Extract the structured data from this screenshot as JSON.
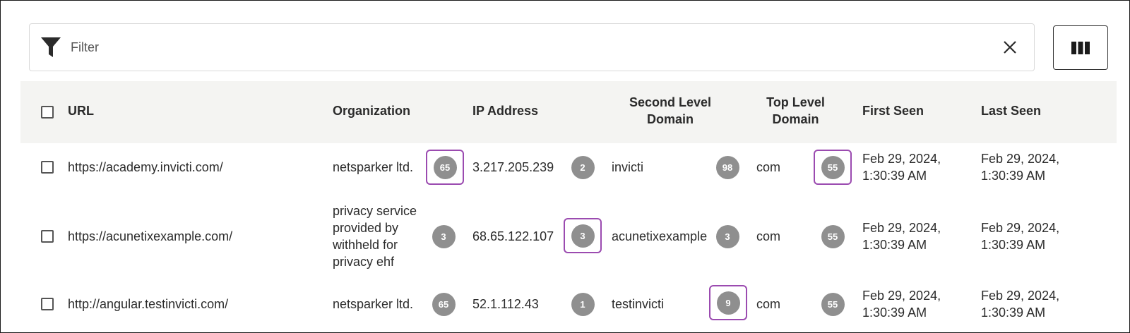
{
  "filter": {
    "placeholder": "Filter"
  },
  "icons": {
    "filter": "filter-funnel-icon",
    "clear": "close-x-icon",
    "columns": "columns-icon"
  },
  "colors": {
    "highlight": "#9b4bb0",
    "badge": "#8f8f8f",
    "header_bg": "#f4f4f2"
  },
  "table": {
    "headers": {
      "url": "URL",
      "organization": "Organization",
      "ip_address": "IP Address",
      "sld_line1": "Second Level",
      "sld_line2": "Domain",
      "tld_line1": "Top Level",
      "tld_line2": "Domain",
      "first_seen": "First Seen",
      "last_seen": "Last Seen"
    },
    "rows": [
      {
        "url": "https://academy.invicti.com/",
        "org_lines": [
          "netsparker ltd."
        ],
        "org_count": "65",
        "ip": "3.217.205.239",
        "ip_count": "2",
        "sld": "invicti",
        "sld_count": "98",
        "tld": "com",
        "tld_count": "55",
        "first_seen_date": "Feb 29, 2024,",
        "first_seen_time": "1:30:39 AM",
        "last_seen_date": "Feb 29, 2024,",
        "last_seen_time": "1:30:39 AM"
      },
      {
        "url": "https://acunetixexample.com/",
        "org_lines": [
          "privacy service",
          "provided by",
          "withheld for",
          "privacy ehf"
        ],
        "org_count": "3",
        "ip": "68.65.122.107",
        "ip_count": "3",
        "sld": "acunetixexample",
        "sld_count": "3",
        "tld": "com",
        "tld_count": "55",
        "first_seen_date": "Feb 29, 2024,",
        "first_seen_time": "1:30:39 AM",
        "last_seen_date": "Feb 29, 2024,",
        "last_seen_time": "1:30:39 AM"
      },
      {
        "url": "http://angular.testinvicti.com/",
        "org_lines": [
          "netsparker ltd."
        ],
        "org_count": "65",
        "ip": "52.1.112.43",
        "ip_count": "1",
        "sld": "testinvicti",
        "sld_count": "9",
        "tld": "com",
        "tld_count": "55",
        "first_seen_date": "Feb 29, 2024,",
        "first_seen_time": "1:30:39 AM",
        "last_seen_date": "Feb 29, 2024,",
        "last_seen_time": "1:30:39 AM"
      }
    ]
  }
}
